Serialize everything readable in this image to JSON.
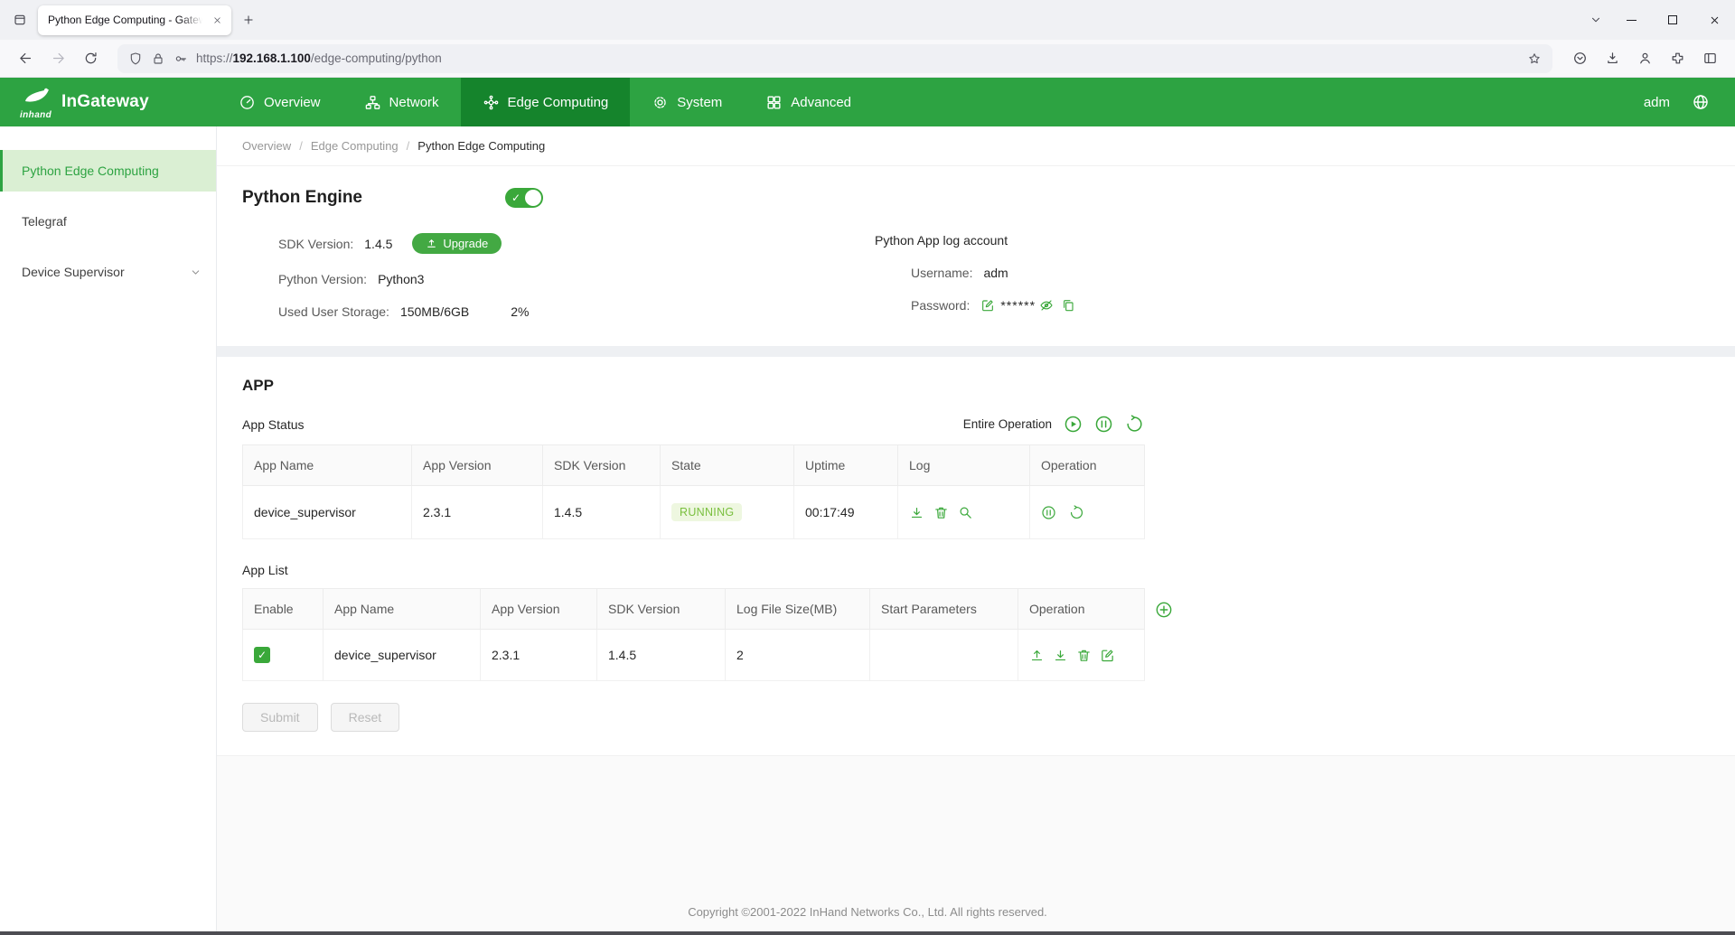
{
  "colors": {
    "brand_green": "#2da342",
    "brand_green_dark": "#15842c",
    "accent_green": "#3aa83a",
    "running_badge_text": "#79bf3e",
    "running_badge_bg": "#eef7e0"
  },
  "browser": {
    "tab": {
      "title": "Python Edge Computing - Gateway"
    },
    "url": {
      "scheme": "https://",
      "host": "192.168.1.100",
      "path": "/edge-computing/python"
    },
    "toolbar_icons": [
      "back-icon",
      "forward-icon",
      "reload-icon",
      "shield-icon",
      "lock-icon",
      "key-icon",
      "bookmark-star-icon",
      "pocket-icon",
      "downloads-icon",
      "account-icon",
      "extensions-icon",
      "sidebar-toggle-icon"
    ]
  },
  "header": {
    "logo": {
      "small": "inhand",
      "name": "InGateway"
    },
    "nav": [
      {
        "label": "Overview",
        "icon": "dashboard-icon",
        "active": false
      },
      {
        "label": "Network",
        "icon": "network-nodes-icon",
        "active": false
      },
      {
        "label": "Edge Computing",
        "icon": "edge-computing-icon",
        "active": true
      },
      {
        "label": "System",
        "icon": "gear-icon",
        "active": false
      },
      {
        "label": "Advanced",
        "icon": "app-grid-icon",
        "active": false
      }
    ],
    "username": "adm",
    "language_icon": "globe-icon"
  },
  "sidebar": {
    "items": [
      {
        "label": "Python Edge Computing",
        "active": true
      },
      {
        "label": "Telegraf",
        "active": false
      },
      {
        "label": "Device Supervisor",
        "active": false,
        "expandable": true
      }
    ]
  },
  "breadcrumb": {
    "items": [
      "Overview",
      "Edge Computing",
      "Python Edge Computing"
    ],
    "separator": "/"
  },
  "python_engine": {
    "title": "Python Engine",
    "enabled": true,
    "sdk_version_label": "SDK Version:",
    "sdk_version": "1.4.5",
    "upgrade_label": "Upgrade",
    "upgrade_icon": "upload-icon",
    "python_version_label": "Python Version:",
    "python_version": "Python3",
    "storage_label": "Used User Storage:",
    "storage_value": "150MB/6GB",
    "storage_percent": "2%",
    "log_account_title": "Python App log account",
    "username_label": "Username:",
    "username": "adm",
    "password_label": "Password:",
    "password_masked": "******",
    "password_icons": [
      "edit-square-icon",
      "eye-off-icon",
      "copy-icon"
    ]
  },
  "app": {
    "title": "APP",
    "status": {
      "label": "App Status",
      "entire_operation_label": "Entire Operation",
      "entire_operation_icons": [
        "play-circle-icon",
        "pause-circle-icon",
        "restart-icon"
      ],
      "table": {
        "headers": [
          "App Name",
          "App Version",
          "SDK Version",
          "State",
          "Uptime",
          "Log",
          "Operation"
        ],
        "rows": [
          {
            "app_name": "device_supervisor",
            "app_version": "2.3.1",
            "sdk_version": "1.4.5",
            "state": "RUNNING",
            "uptime": "00:17:49",
            "log_icons": [
              "export-log-icon",
              "delete-log-icon",
              "view-log-icon"
            ],
            "operation_icons": [
              "pause-circle-icon",
              "restart-icon"
            ]
          }
        ]
      }
    },
    "list": {
      "label": "App List",
      "add_icon": "plus-circle-icon",
      "table": {
        "headers": [
          "Enable",
          "App Name",
          "App Version",
          "SDK Version",
          "Log File Size(MB)",
          "Start Parameters",
          "Operation"
        ],
        "rows": [
          {
            "enabled": true,
            "app_name": "device_supervisor",
            "app_version": "2.3.1",
            "sdk_version": "1.4.5",
            "log_file_size": "2",
            "start_parameters": "",
            "operation_icons": [
              "upload-icon",
              "download-icon",
              "delete-icon",
              "edit-square-icon"
            ]
          }
        ]
      }
    },
    "submit_label": "Submit",
    "reset_label": "Reset"
  },
  "footer": {
    "copyright": "Copyright ©2001-2022 InHand Networks Co., Ltd. All rights reserved."
  }
}
